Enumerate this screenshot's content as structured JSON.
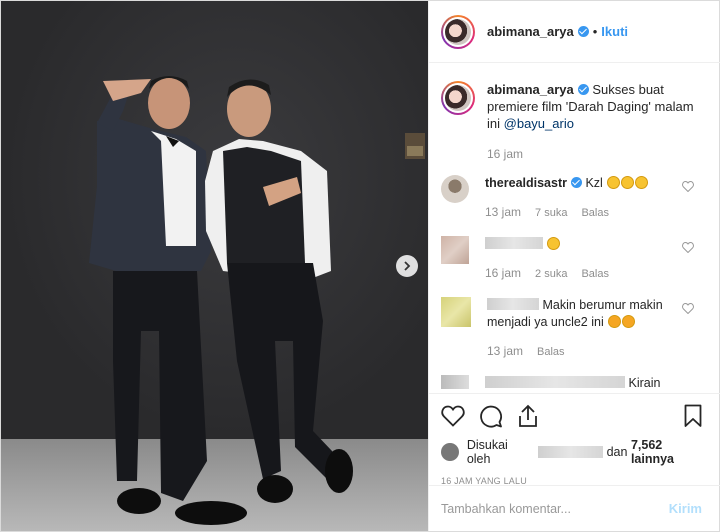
{
  "header": {
    "username": "abimana_arya",
    "separator": "•",
    "follow_label": "Ikuti"
  },
  "caption": {
    "username": "abimana_arya",
    "text": "Sukses buat premiere film 'Darah Daging' malam ini",
    "mention": "@bayu_ario",
    "time": "16 jam"
  },
  "comments": [
    {
      "username": "therealdisastr",
      "text": "Kzl",
      "emoji_count": 3,
      "time": "13 jam",
      "likes": "7 suka",
      "reply": "Balas"
    },
    {
      "username": "",
      "text": "",
      "emoji_count": 1,
      "time": "16 jam",
      "likes": "2 suka",
      "reply": "Balas"
    },
    {
      "username": "",
      "text": "Makin berumur makin menjadi ya uncle2 ini",
      "emoji_count": 2,
      "time": "13 jam",
      "likes": "",
      "reply": "Balas"
    },
    {
      "username": "",
      "text": "Kirain",
      "emoji_count": 0,
      "time": "",
      "likes": "",
      "reply": ""
    }
  ],
  "likes": {
    "prefix": "Disukai oleh",
    "and": "dan",
    "count": "7,562 lainnya"
  },
  "time_ago": "16 JAM YANG LALU",
  "add_comment": {
    "placeholder": "Tambahkan komentar...",
    "post_label": "Kirim"
  },
  "colors": {
    "accent": "#3897f0",
    "post_disabled": "#b2dffc",
    "meta_text": "#8e8e8e"
  },
  "icons": [
    "heart-icon",
    "comment-icon",
    "share-icon",
    "bookmark-icon",
    "chevron-right-icon",
    "verified-icon"
  ]
}
